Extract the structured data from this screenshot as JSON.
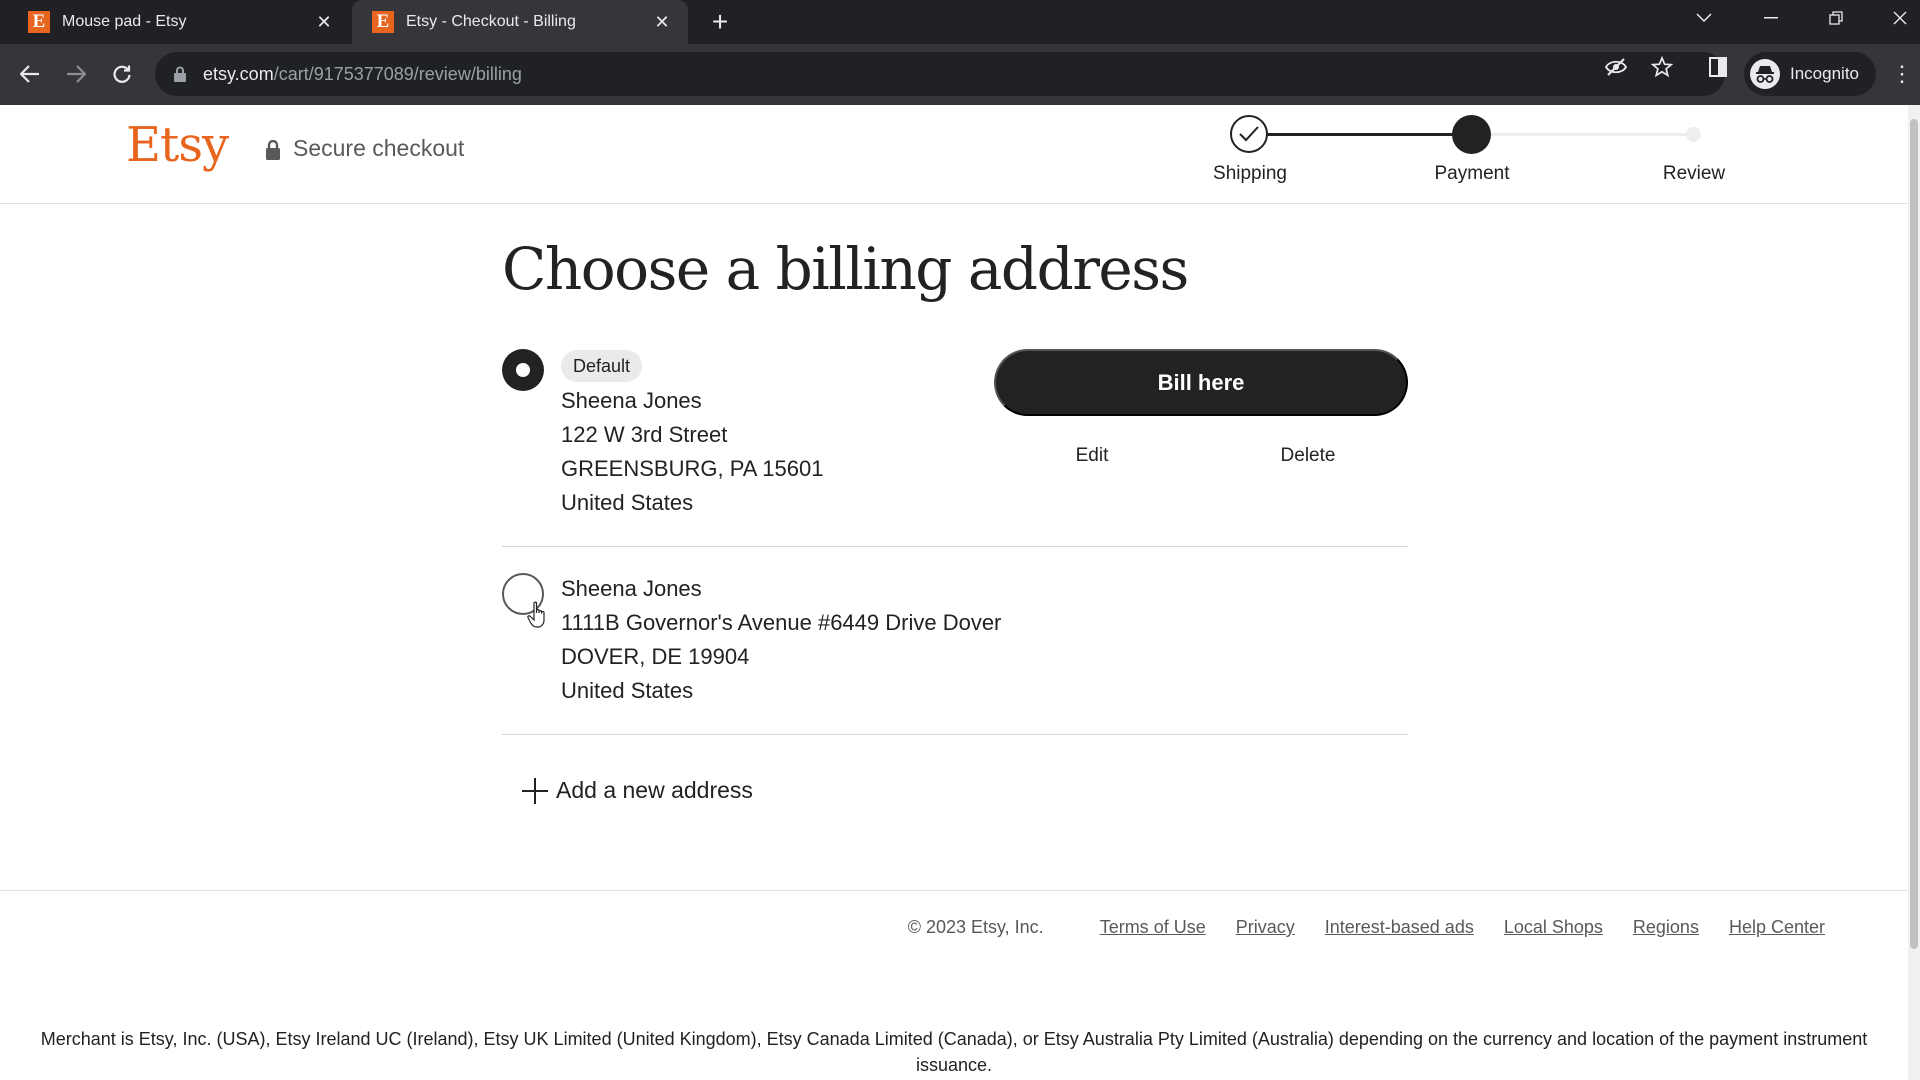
{
  "browser": {
    "tabs": [
      {
        "title": "Mouse pad - Etsy",
        "favicon": "E",
        "active": false
      },
      {
        "title": "Etsy - Checkout - Billing",
        "favicon": "E",
        "active": true
      }
    ],
    "new_tab": "+",
    "url_domain": "etsy.com",
    "url_path": "/cart/9175377089/review/billing",
    "profile_label": "Incognito"
  },
  "header": {
    "logo": "Etsy",
    "secure_label": "Secure checkout",
    "steps": [
      {
        "label": "Shipping",
        "state": "completed"
      },
      {
        "label": "Payment",
        "state": "current"
      },
      {
        "label": "Review",
        "state": "upcoming"
      }
    ]
  },
  "main": {
    "title": "Choose a billing address",
    "addresses": [
      {
        "selected": true,
        "badge": "Default",
        "name": "Sheena Jones",
        "street": "122 W 3rd Street",
        "city_line": "GREENSBURG, PA 15601",
        "country": "United States"
      },
      {
        "selected": false,
        "name": "Sheena Jones",
        "street": "1111B Governor's Avenue #6449 Drive Dover",
        "city_line": "DOVER, DE 19904",
        "country": "United States"
      }
    ],
    "bill_here_label": "Bill here",
    "edit_label": "Edit",
    "delete_label": "Delete",
    "add_address_label": "Add a new address"
  },
  "footer": {
    "copyright": "© 2023 Etsy, Inc.",
    "links": [
      "Terms of Use",
      "Privacy",
      "Interest-based ads",
      "Local Shops",
      "Regions",
      "Help Center"
    ],
    "merchant_text": "Merchant is Etsy, Inc. (USA), Etsy Ireland UC (Ireland), Etsy UK Limited (United Kingdom), Etsy Canada Limited (Canada), or Etsy Australia Pty Limited (Australia) depending on the currency and location of the payment instrument issuance."
  },
  "colors": {
    "brand": "#e8651d",
    "primary_button": "#222222",
    "chrome_dark": "#202124",
    "chrome_toolbar": "#35363a"
  }
}
